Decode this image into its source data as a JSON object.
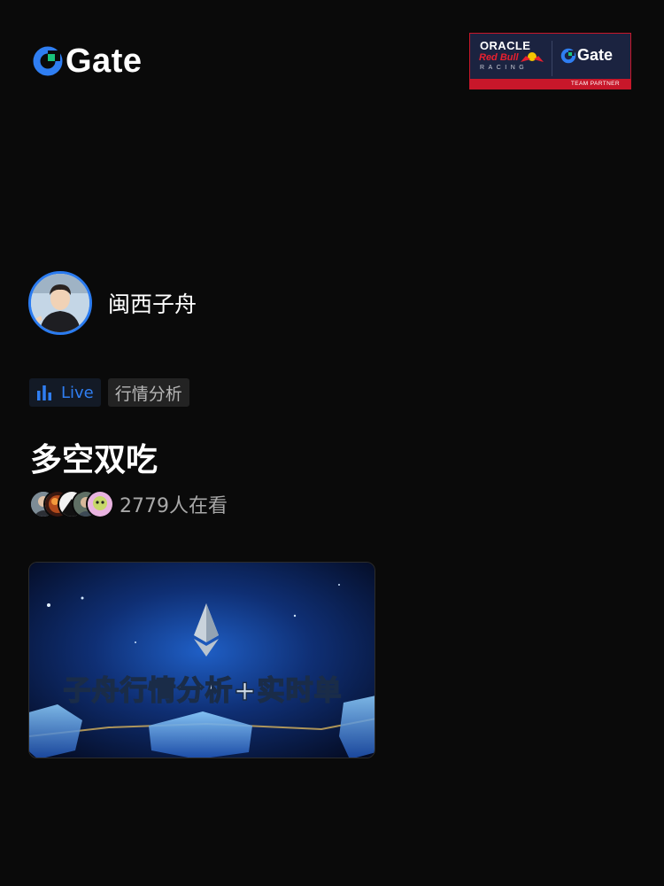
{
  "header": {
    "logo_text": "Gate",
    "partner": {
      "oracle": "ORACLE",
      "redbull": "Red Bull",
      "racing": "RACING",
      "gate_text": "Gate",
      "team_partner": "TEAM PARTNER"
    }
  },
  "host": {
    "name": "闽西子舟"
  },
  "tags": {
    "live_label": "Live",
    "category": "行情分析"
  },
  "stream": {
    "title": "多空双吃",
    "viewer_count": "2779人在看",
    "thumbnail_text": "子舟行情分析+实时单"
  },
  "colors": {
    "background": "#0a0a0a",
    "accent_blue": "#2f7ef2",
    "gate_green": "#19c37d",
    "partner_red": "#c8172a"
  }
}
